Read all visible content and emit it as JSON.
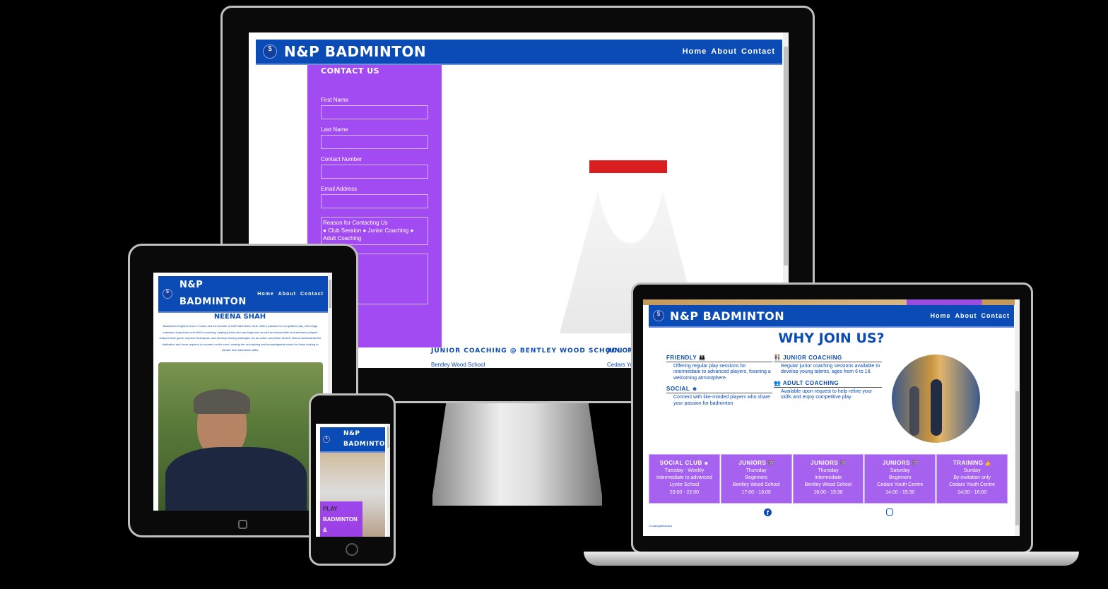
{
  "site": {
    "brand": "N&P BADMINTON",
    "brand_line1": "N&P",
    "brand_line2": "BADMINTON",
    "nav": [
      "Home",
      "About",
      "Contact"
    ]
  },
  "desktop": {
    "contact_title": "CONTACT US",
    "fields": [
      "First Name",
      "Last Name",
      "Contact Number",
      "Email Address"
    ],
    "reason_legend": "Reason for Contacting Us",
    "reasons": [
      "Club Session",
      "Junior Coaching",
      "Adult Coaching"
    ],
    "venue1_title": "JUNIOR COACHING @ BENTLEY WOOD SCHOOL",
    "venue1_text": "Bentley Wood School",
    "venue2_title": "JUNIOR",
    "venue2_text": "Cedars Yo"
  },
  "tablet": {
    "name": "NEENA SHAH",
    "bio": "Badminton England Level 2 Coach and the founder of N&P Badminton Club. With a passion for competitive play, she brings extensive experience and skill to coaching, helping juniors who are beginners as well as intermediate and advanced players sharpen their game, improve techniques, and develop winning strategies. As an active competitor herself, Neena understands the dedication and focus required to succeed on the court, making her an inspiring and knowledgeable coach for those looking to elevate their badminton skills."
  },
  "phone": {
    "hero": [
      "PLAY",
      "BADMINTON",
      "&"
    ]
  },
  "laptop": {
    "title": "WHY JOIN US?",
    "features": [
      {
        "title": "FRIENDLY",
        "text": "Offering regular play sessions for intermediate to advanced players, fosering a welcoming atmostphere."
      },
      {
        "title": "SOCIAL",
        "text": "Connect with like-minded players who share your passion for badminton"
      },
      {
        "title": "JUNIOR COACHING",
        "text": "Regular junior coaching sessions available to develop young talents, ages from 6 to 18."
      },
      {
        "title": "ADULT COACHING",
        "text": "Available upon request to help refine your skills and enjoy competitive play"
      }
    ],
    "sessions": [
      {
        "title": "SOCIAL CLUB",
        "lines": [
          "Tuesday - Weekly",
          "Intermediate to advanced",
          "Lycée School",
          "20:00 - 22:00"
        ]
      },
      {
        "title": "JUNIORS",
        "lines": [
          "Thursday",
          "Beginners",
          "Bentley Wood School",
          "17:00 - 18:00"
        ]
      },
      {
        "title": "JUNIORS",
        "lines": [
          "Thursday",
          "Intermediate",
          "Bentley Wood School",
          "18:00 - 19:30"
        ]
      },
      {
        "title": "JUNIORS",
        "lines": [
          "Saturday",
          "Beginners",
          "Cedars Youth Centre",
          "14:00 - 15:30"
        ]
      },
      {
        "title": "TRAINING",
        "lines": [
          "Sunday",
          "By invitation only",
          "Cedars Youth Centre",
          "14:00 - 16:00"
        ]
      }
    ],
    "footer": "©CodingwithLeora"
  },
  "colors": {
    "brand_blue": "#0a4bb5",
    "purple": "#9632f0"
  }
}
